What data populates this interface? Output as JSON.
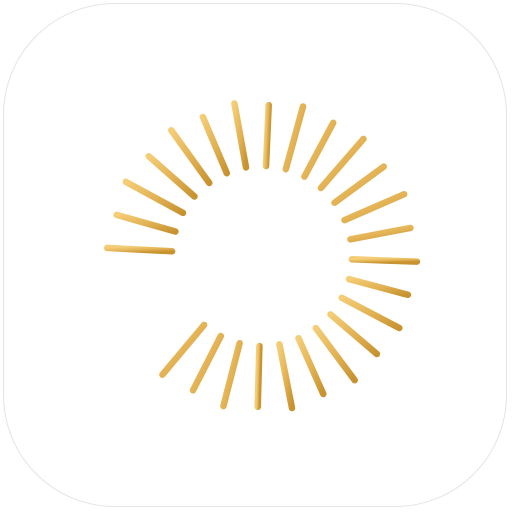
{
  "icon": {
    "name": "sunburst-c-logo",
    "ray_count": 25,
    "arc_start_deg": -87,
    "arc_end_deg": 220,
    "colors": {
      "background": "#ffffff",
      "border": "#e4e4e4",
      "gold_light": "#f4cd76",
      "gold_mid": "#e3b355",
      "gold_dark": "#c7922f"
    }
  }
}
